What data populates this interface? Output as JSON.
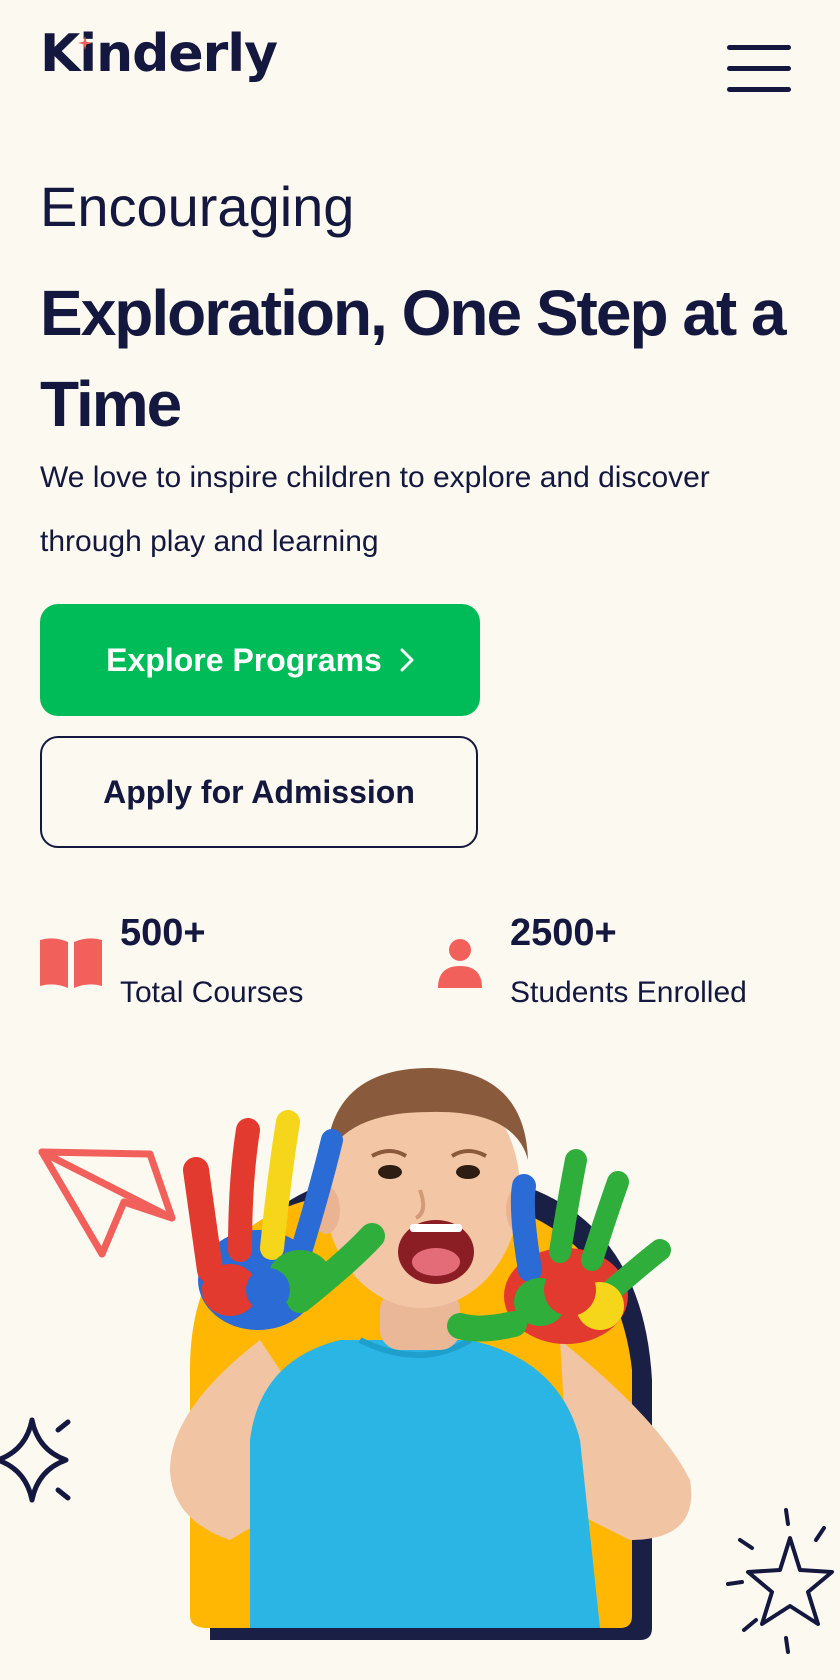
{
  "header": {
    "logo_text": "Kinderly",
    "menu_icon": "hamburger-menu-icon"
  },
  "hero": {
    "kicker": "Encouraging",
    "headline": "Exploration, One Step at a Time",
    "subtext": "We love to inspire children to explore and discover through play and learning"
  },
  "buttons": {
    "primary_label": "Explore Programs",
    "primary_icon": "chevron-right-icon",
    "secondary_label": "Apply for Admission"
  },
  "stats": [
    {
      "icon": "open-book-icon",
      "value": "500+",
      "label": "Total Courses"
    },
    {
      "icon": "user-icon",
      "value": "2500+",
      "label": "Students Enrolled"
    }
  ],
  "colors": {
    "background": "#fcf9f1",
    "navy": "#14183f",
    "green": "#00bc58",
    "coral": "#f2605b",
    "yellow": "#ffb703",
    "shirt": "#2bb5e5"
  },
  "decorations": [
    "paper-plane-icon",
    "sparkle-icon",
    "star-burst-icon"
  ]
}
